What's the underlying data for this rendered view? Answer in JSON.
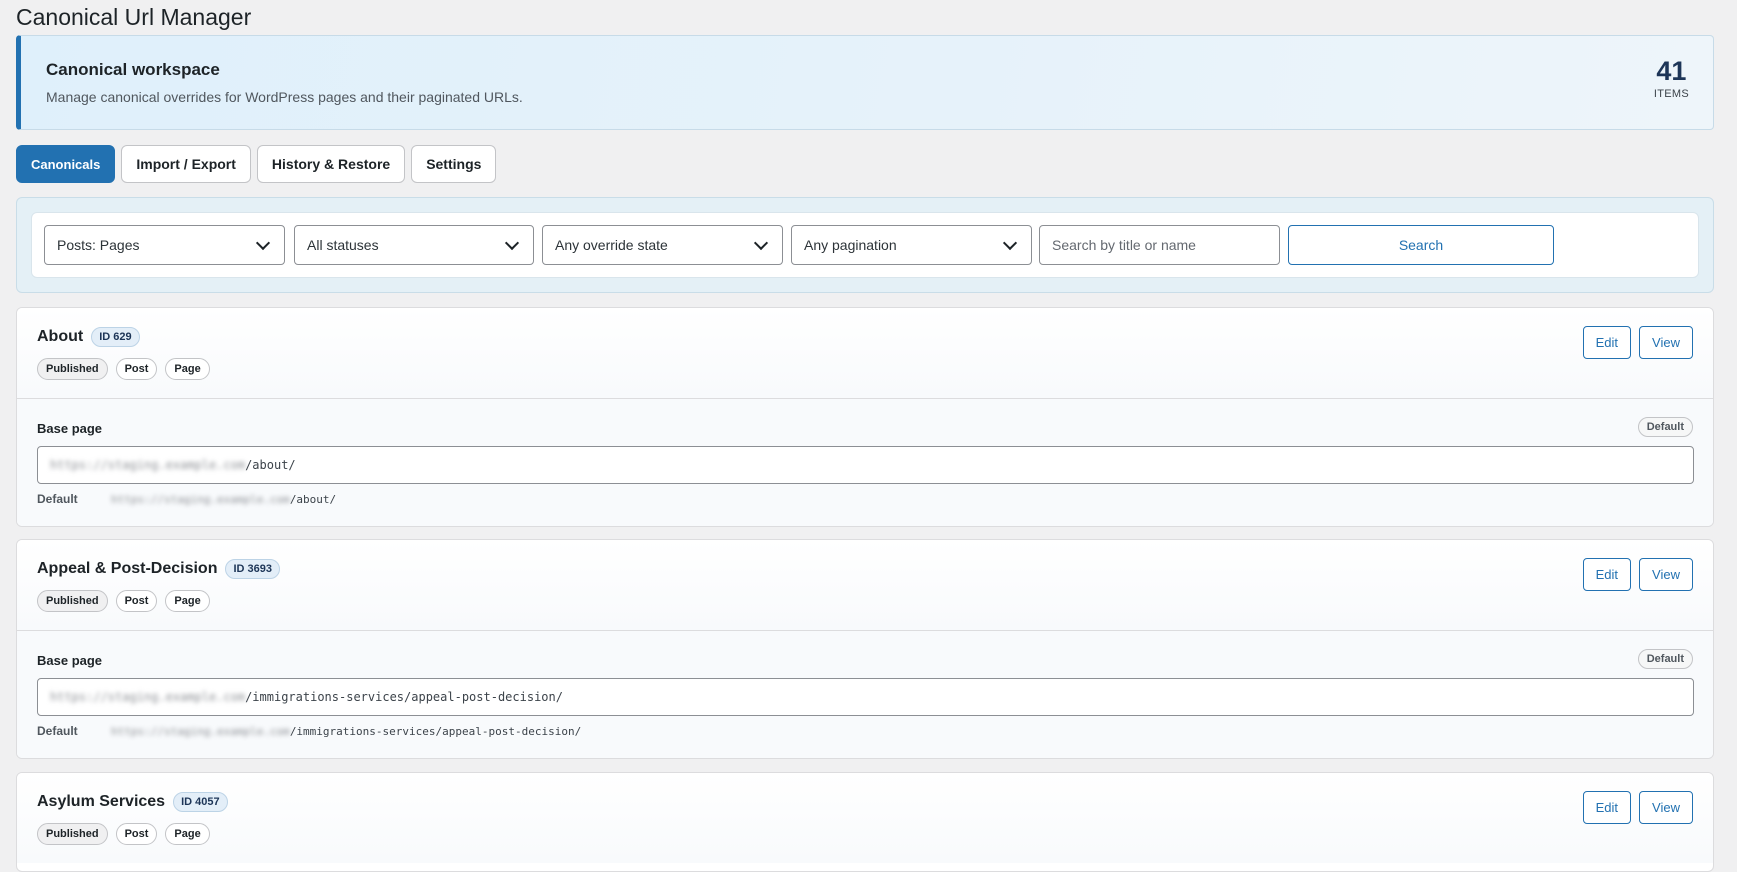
{
  "page": {
    "title": "Canonical Url Manager"
  },
  "hero": {
    "title": "Canonical workspace",
    "subtitle": "Manage canonical overrides for WordPress pages and their paginated URLs.",
    "count": "41",
    "count_label": "ITEMS"
  },
  "tabs": [
    {
      "label": "Canonicals",
      "active": true
    },
    {
      "label": "Import / Export",
      "active": false
    },
    {
      "label": "History & Restore",
      "active": false
    },
    {
      "label": "Settings",
      "active": false
    }
  ],
  "filters": {
    "post_type": "Posts: Pages",
    "status": "All statuses",
    "override": "Any override state",
    "pagination": "Any pagination",
    "search_placeholder": "Search by title or name",
    "search_button": "Search"
  },
  "items": [
    {
      "title": "About",
      "id": "ID 629",
      "chips": [
        "Published",
        "Post",
        "Page"
      ],
      "edit": "Edit",
      "view": "View",
      "base_label": "Base page",
      "default_pill": "Default",
      "url_host": "https://staging.example.com",
      "url_path": "/about/",
      "default_label": "Default",
      "default_host": "https://staging.example.com",
      "default_path": "/about/"
    },
    {
      "title": "Appeal & Post-Decision",
      "id": "ID 3693",
      "chips": [
        "Published",
        "Post",
        "Page"
      ],
      "edit": "Edit",
      "view": "View",
      "base_label": "Base page",
      "default_pill": "Default",
      "url_host": "https://staging.example.com",
      "url_path": "/immigrations-services/appeal-post-decision/",
      "default_label": "Default",
      "default_host": "https://staging.example.com",
      "default_path": "/immigrations-services/appeal-post-decision/"
    },
    {
      "title": "Asylum Services",
      "id": "ID 4057",
      "chips": [
        "Published",
        "Post",
        "Page"
      ],
      "edit": "Edit",
      "view": "View"
    }
  ],
  "colors": {
    "primary": "#2271b1",
    "background": "#f0f0f1",
    "hero_bg": "#e4f0f8"
  }
}
